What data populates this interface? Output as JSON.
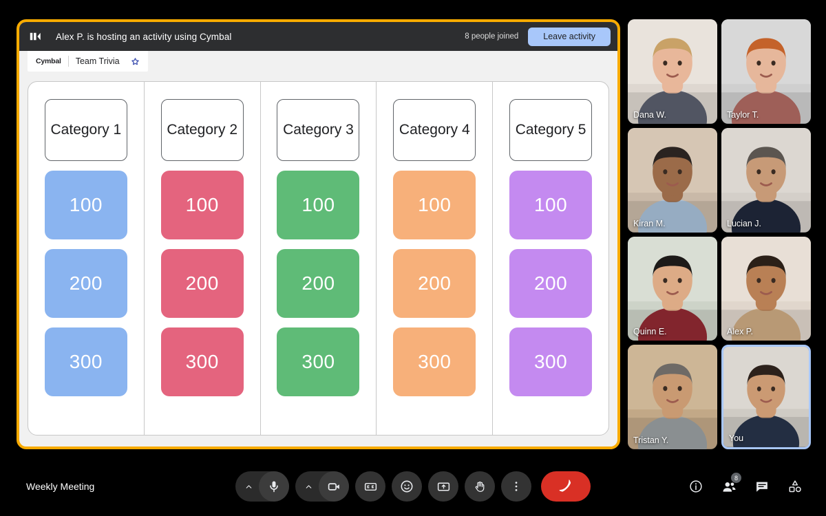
{
  "activity": {
    "logo_icon": "cymbal-logo-icon",
    "host_text": "Alex P. is hosting an activity using Cymbal",
    "joined_count_text": "8 people joined",
    "leave_button_label": "Leave activity",
    "tab": {
      "brand": "Cymbal",
      "title": "Team Trivia",
      "star_icon": "star-icon"
    },
    "board": {
      "columns": [
        {
          "category": "Category 1",
          "color": "#8ab4f0",
          "values": [
            "100",
            "200",
            "300"
          ]
        },
        {
          "category": "Category 2",
          "color": "#e4647e",
          "values": [
            "100",
            "200",
            "300"
          ]
        },
        {
          "category": "Category 3",
          "color": "#5fbb77",
          "values": [
            "100",
            "200",
            "300"
          ]
        },
        {
          "category": "Category 4",
          "color": "#f7b07a",
          "values": [
            "100",
            "200",
            "300"
          ]
        },
        {
          "category": "Category 5",
          "color": "#c48af0",
          "values": [
            "100",
            "200",
            "300"
          ]
        }
      ]
    }
  },
  "participants": [
    {
      "name": "Dana W.",
      "is_you": false
    },
    {
      "name": "Taylor T.",
      "is_you": false
    },
    {
      "name": "Kiran M.",
      "is_you": false
    },
    {
      "name": "Lucian J.",
      "is_you": false
    },
    {
      "name": "Quinn E.",
      "is_you": false
    },
    {
      "name": "Alex P.",
      "is_you": false
    },
    {
      "name": "Tristan Y.",
      "is_you": false
    },
    {
      "name": "You",
      "is_you": true
    }
  ],
  "bottom_bar": {
    "meeting_title": "Weekly Meeting",
    "controls": [
      {
        "icon": "microphone-icon",
        "has_chevron": true
      },
      {
        "icon": "camera-icon",
        "has_chevron": true
      },
      {
        "icon": "closed-captions-icon",
        "has_chevron": false
      },
      {
        "icon": "emoji-reaction-icon",
        "has_chevron": false
      },
      {
        "icon": "present-screen-icon",
        "has_chevron": false
      },
      {
        "icon": "raise-hand-icon",
        "has_chevron": false
      },
      {
        "icon": "more-options-icon",
        "has_chevron": false
      }
    ],
    "end_call": {
      "icon": "end-call-icon",
      "color": "#d93025"
    },
    "right_icons": [
      {
        "icon": "info-icon",
        "badge": ""
      },
      {
        "icon": "people-icon",
        "badge": "8"
      },
      {
        "icon": "chat-icon",
        "badge": ""
      },
      {
        "icon": "activities-icon",
        "badge": ""
      }
    ]
  },
  "colors": {
    "accent_yellow": "#f9ab00",
    "accent_blue": "#a8c7fa",
    "end_call_red": "#d93025"
  }
}
